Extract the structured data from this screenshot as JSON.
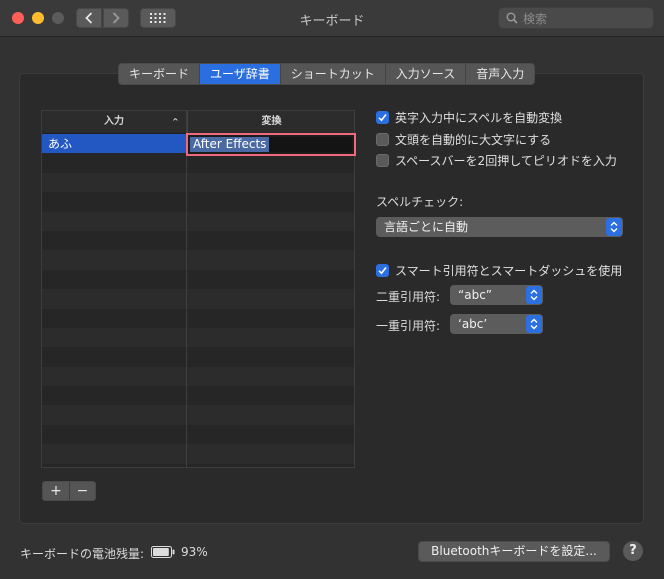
{
  "window": {
    "title": "キーボード",
    "search_placeholder": "検索"
  },
  "tabs": [
    {
      "label": "キーボード",
      "active": false
    },
    {
      "label": "ユーザ辞書",
      "active": true
    },
    {
      "label": "ショートカット",
      "active": false
    },
    {
      "label": "入力ソース",
      "active": false
    },
    {
      "label": "音声入力",
      "active": false
    }
  ],
  "dictionary": {
    "col_input": "入力",
    "col_convert": "変換",
    "sort_indicator": "^",
    "entries": [
      {
        "input": "あふ",
        "convert": "After Effects"
      }
    ],
    "add_label": "+",
    "remove_label": "−"
  },
  "options": {
    "auto_spell": {
      "label": "英字入力中にスペルを自動変換",
      "checked": true
    },
    "auto_capitalize": {
      "label": "文頭を自動的に大文字にする",
      "checked": false
    },
    "double_space_period": {
      "label": "スペースバーを2回押してピリオドを入力",
      "checked": false
    },
    "spell_check_label": "スペルチェック:",
    "spell_check_value": "言語ごとに自動",
    "smart_quotes": {
      "label": "スマート引用符とスマートダッシュを使用",
      "checked": true
    },
    "double_quote_label": "二重引用符:",
    "double_quote_value": "“abc”",
    "single_quote_label": "一重引用符:",
    "single_quote_value": "‘abc’"
  },
  "footer": {
    "battery_label": "キーボードの電池残量:",
    "battery_percent": "93%",
    "battery_level": 0.93,
    "bluetooth_button": "Bluetoothキーボードを設定...",
    "help_label": "?"
  },
  "colors": {
    "accent": "#2b6fe0",
    "selection": "#2358c2",
    "edit_highlight": "#f06a7c"
  }
}
